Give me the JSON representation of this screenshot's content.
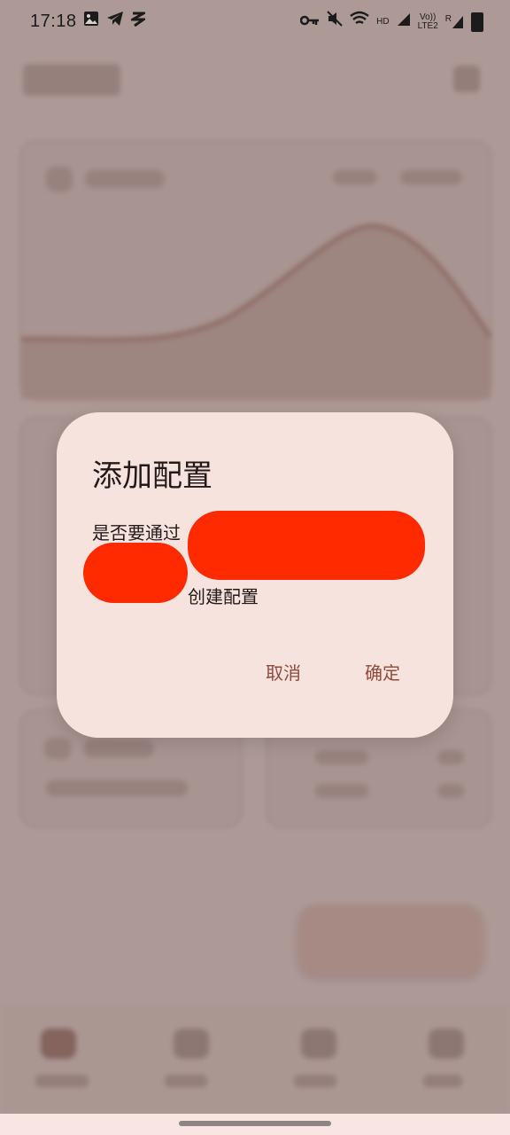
{
  "status_bar": {
    "time": "17:18",
    "left_icons": [
      "image-icon",
      "telegram-icon",
      "wifi-share-icon"
    ],
    "right_icons": [
      "vpn-key-icon",
      "mute-icon",
      "wifi-icon",
      "hd-badge",
      "signal-icon",
      "volte-badge",
      "signal-roaming-icon",
      "battery-icon"
    ],
    "hd_label": "HD",
    "volte_label_top": "Vo))",
    "volte_label_bottom": "LTE2",
    "roaming_label": "R"
  },
  "dialog": {
    "title": "添加配置",
    "body_line1": "是否要通过",
    "body_line3": "创建配置",
    "cancel_label": "取消",
    "confirm_label": "确定"
  },
  "colors": {
    "dialog_bg": "#f7e3de",
    "accent": "#8f4a3c",
    "redaction": "#ff2a00"
  }
}
